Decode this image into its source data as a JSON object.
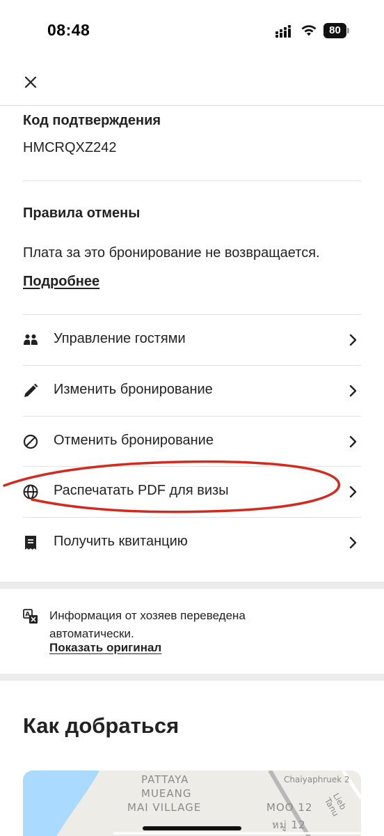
{
  "status_bar": {
    "time": "08:48",
    "battery": "80"
  },
  "header": {
    "close_icon": "close-icon"
  },
  "confirmation": {
    "label": "Код подтверждения",
    "code": "HMCRQXZ242"
  },
  "cancellation_policy": {
    "title": "Правила отмены",
    "text": "Плата за это бронирование не возвращается.",
    "more_link": "Подробнее"
  },
  "actions": [
    {
      "label": "Управление гостями",
      "icon": "guests-icon"
    },
    {
      "label": "Изменить бронирование",
      "icon": "pencil-icon"
    },
    {
      "label": "Отменить бронирование",
      "icon": "cancel-icon"
    },
    {
      "label": "Распечатать PDF для визы",
      "icon": "globe-icon"
    },
    {
      "label": "Получить квитанцию",
      "icon": "receipt-icon"
    }
  ],
  "translation": {
    "text": "Информация от хозяев переведена автоматически.",
    "link": "Показать оригинал"
  },
  "directions": {
    "title": "Как добраться"
  },
  "map": {
    "labels": [
      "PATTAYA",
      "MUEANG",
      "MAI VILLAGE",
      "MOO 12",
      "หมู่ 12"
    ],
    "roads": [
      "Chaiyaphruek 2",
      "Lieb Tanu"
    ]
  },
  "colors": {
    "text": "#222222",
    "divider": "#e2e2e2",
    "annotation": "#d42a1e",
    "sea": "#aadaff"
  }
}
